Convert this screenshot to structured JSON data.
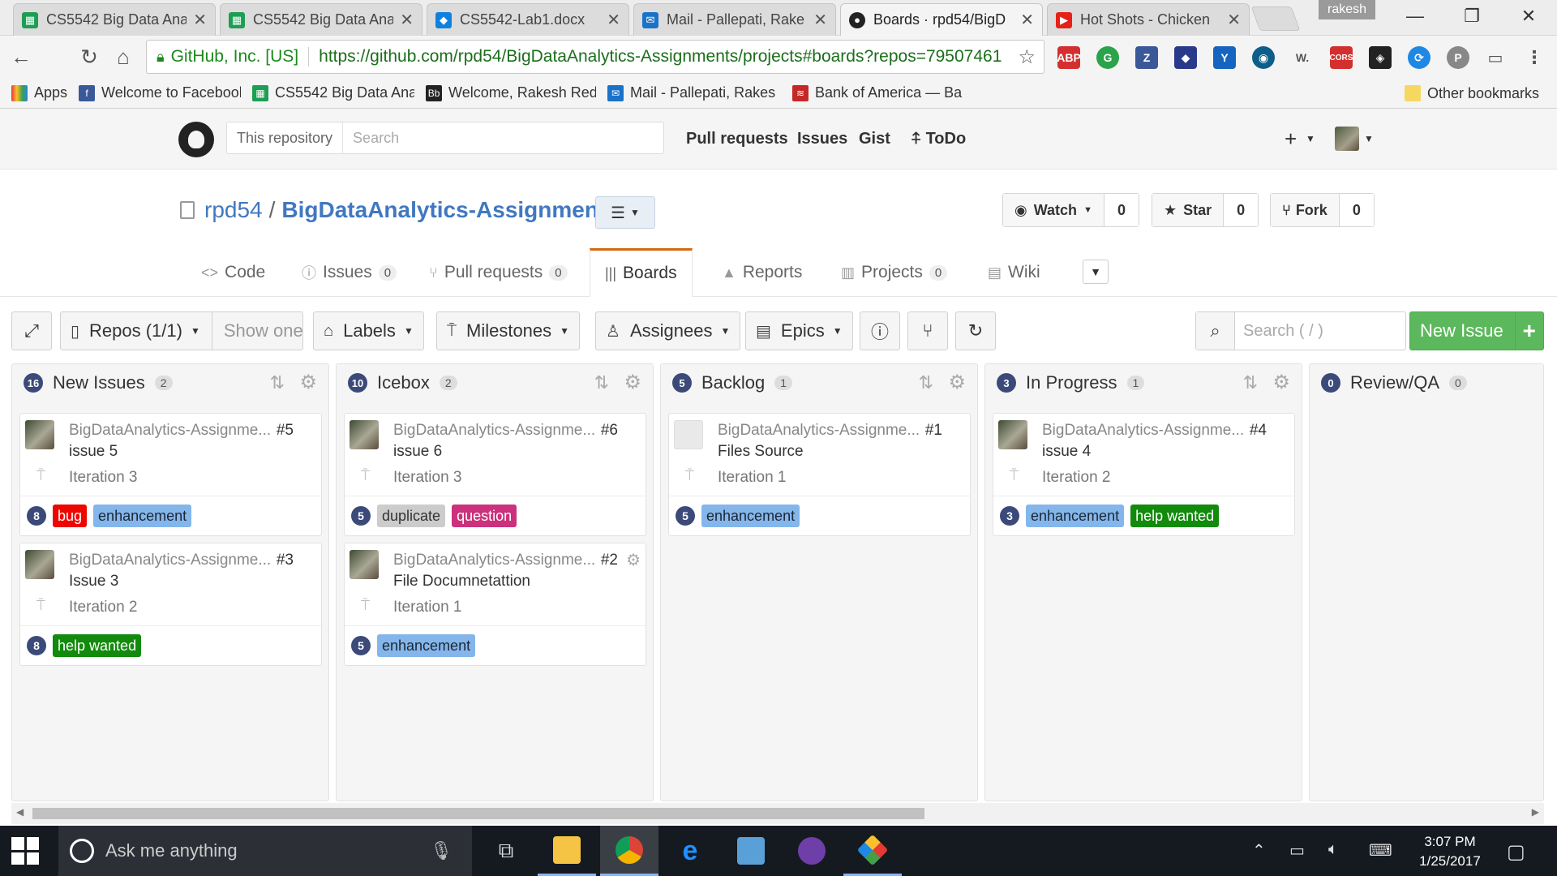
{
  "browser": {
    "tabs": [
      {
        "title": "CS5542 Big Data Ana",
        "icon": "sheets-icon"
      },
      {
        "title": "CS5542 Big Data Ana",
        "icon": "sheets-icon"
      },
      {
        "title": "CS5542-Lab1.docx",
        "icon": "dropbox-icon"
      },
      {
        "title": "Mail - Pallepati, Rake",
        "icon": "mail-icon"
      },
      {
        "title": "Boards · rpd54/BigD",
        "icon": "github-icon"
      },
      {
        "title": "Hot Shots - Chicken",
        "icon": "youtube-icon"
      }
    ],
    "profile_name": "rakesh",
    "security_org": "GitHub, Inc. [US]",
    "url": "https://github.com/rpd54/BigDataAnalytics-Assignments/projects#boards?repos=79507461",
    "bookmarks": [
      "Apps",
      "Welcome to Facebook",
      "CS5542 Big Data Anal",
      "Welcome, Rakesh Red",
      "Mail - Pallepati, Rakes",
      "Bank of America — Ba"
    ],
    "other_bookmarks": "Other bookmarks"
  },
  "github": {
    "search_scope": "This repository",
    "search_placeholder": "Search",
    "nav": [
      "Pull requests",
      "Issues",
      "Gist",
      "ToDo"
    ],
    "owner": "rpd54",
    "separator": "/",
    "repo": "BigDataAnalytics-Assignments",
    "watch": {
      "label": "Watch",
      "count": "0"
    },
    "star": {
      "label": "Star",
      "count": "0"
    },
    "fork": {
      "label": "Fork",
      "count": "0"
    },
    "tabs": [
      {
        "label": "Code",
        "count": ""
      },
      {
        "label": "Issues",
        "count": "0"
      },
      {
        "label": "Pull requests",
        "count": "0"
      },
      {
        "label": "Boards",
        "count": ""
      },
      {
        "label": "Reports",
        "count": ""
      },
      {
        "label": "Projects",
        "count": "0"
      },
      {
        "label": "Wiki",
        "count": ""
      }
    ]
  },
  "board": {
    "filters": {
      "repos": "Repos (1/1)",
      "show_one": "Show one",
      "labels": "Labels",
      "milestones": "Milestones",
      "assignees": "Assignees",
      "epics": "Epics"
    },
    "search_placeholder": "Search ( / )",
    "new_issue": "New Issue",
    "pipelines": [
      {
        "name": "New Issues",
        "points": "16",
        "count": "2",
        "cards": [
          {
            "repo": "BigDataAnalytics-Assignme...",
            "number": "#5",
            "title": "issue 5",
            "milestone": "Iteration 3",
            "estimate": "8",
            "labels": [
              {
                "text": "bug",
                "bg": "#ee0701",
                "fg": "#ffffff"
              },
              {
                "text": "enhancement",
                "bg": "#84b6eb",
                "fg": "#1c2733"
              }
            ]
          },
          {
            "repo": "BigDataAnalytics-Assignme...",
            "number": "#3",
            "title": "Issue 3",
            "milestone": "Iteration 2",
            "estimate": "8",
            "labels": [
              {
                "text": "help wanted",
                "bg": "#128a0c",
                "fg": "#ffffff"
              }
            ]
          }
        ]
      },
      {
        "name": "Icebox",
        "points": "10",
        "count": "2",
        "cards": [
          {
            "repo": "BigDataAnalytics-Assignme...",
            "number": "#6",
            "title": "issue 6",
            "milestone": "Iteration 3",
            "estimate": "5",
            "labels": [
              {
                "text": "duplicate",
                "bg": "#cccccc",
                "fg": "#333333"
              },
              {
                "text": "question",
                "bg": "#cc317c",
                "fg": "#ffffff"
              }
            ]
          },
          {
            "repo": "BigDataAnalytics-Assignme...",
            "number": "#2",
            "title": "File Documnetattion",
            "milestone": "Iteration 1",
            "estimate": "5",
            "labels": [
              {
                "text": "enhancement",
                "bg": "#84b6eb",
                "fg": "#1c2733"
              }
            ]
          }
        ]
      },
      {
        "name": "Backlog",
        "points": "5",
        "count": "1",
        "cards": [
          {
            "repo": "BigDataAnalytics-Assignme...",
            "number": "#1",
            "title": "Files Source",
            "milestone": "Iteration 1",
            "estimate": "5",
            "labels": [
              {
                "text": "enhancement",
                "bg": "#84b6eb",
                "fg": "#1c2733"
              }
            ]
          }
        ]
      },
      {
        "name": "In Progress",
        "points": "3",
        "count": "1",
        "cards": [
          {
            "repo": "BigDataAnalytics-Assignme...",
            "number": "#4",
            "title": "issue 4",
            "milestone": "Iteration 2",
            "estimate": "3",
            "labels": [
              {
                "text": "enhancement",
                "bg": "#84b6eb",
                "fg": "#1c2733"
              },
              {
                "text": "help wanted",
                "bg": "#128a0c",
                "fg": "#ffffff"
              }
            ]
          }
        ]
      },
      {
        "name": "Review/QA",
        "points": "0",
        "count": "0",
        "cards": []
      }
    ]
  },
  "taskbar": {
    "search_placeholder": "Ask me anything",
    "time": "3:07 PM",
    "date": "1/25/2017"
  }
}
